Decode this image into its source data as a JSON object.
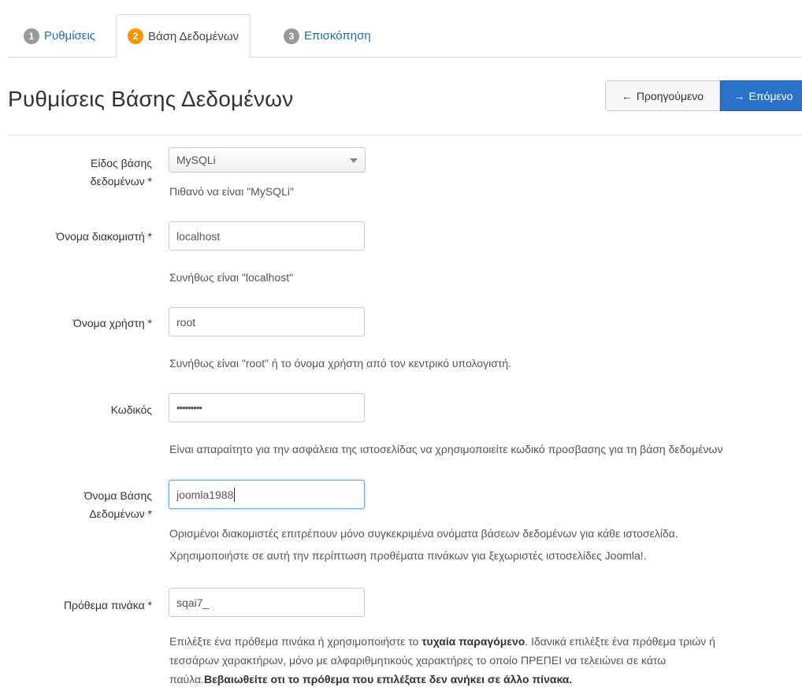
{
  "tabs": [
    {
      "num": "1",
      "label": "Ρυθμίσεις"
    },
    {
      "num": "2",
      "label": "Βάση Δεδομένων"
    },
    {
      "num": "3",
      "label": "Επισκόπηση"
    }
  ],
  "header": {
    "title": "Ρυθμίσεις Βάσης Δεδομένων",
    "prev_label": "Προηγούμενο",
    "next_label": "Επόμενο"
  },
  "form": {
    "db_type": {
      "label_line1": "Είδος βάσης",
      "label_line2": "δεδομένων *",
      "value": "MySQLi",
      "help": "Πιθανό να είναι \"MySQLi\""
    },
    "host": {
      "label": "Όνομα διακομιστή *",
      "value": "localhost",
      "help": "Συνήθως είναι \"localhost\""
    },
    "user": {
      "label": "Όνομα χρήστη *",
      "value": "root",
      "help": "Συνήθως είναι \"root\" ή το όνομα χρήστη από τον κεντρικό υπολογιστή."
    },
    "password": {
      "label": "Κωδικός",
      "value": "•••••••••",
      "help": "Είναι απαραίτητο για την ασφάλεια της ιστοσελίδας να χρησιμοποιείτε κωδικό προσβασης για τη βάση δεδομένων"
    },
    "db_name": {
      "label_line1": "Όνομα Βάσης",
      "label_line2": "Δεδομένων *",
      "value": "joomla1988",
      "help_line1": "Ορισμένοι διακομιστές επιτρέπουν μόνο συγκεκριμένα ονόματα βάσεων δεδομένων για κάθε ιστοσελίδα.",
      "help_line2": "Χρησιμοποιήστε σε αυτή την περίπτωση προθέματα πινάκων για ξεχωριστές ιστοσελίδες Joomla!."
    },
    "prefix": {
      "label": "Πρόθεμα πινάκα *",
      "value": "sqai7_",
      "help_line1_a": "Επιλέξτε ένα πρόθεμα πινάκα ή χρησιμοποιήστε το ",
      "help_line1_b": "τυχαία παραγόμενο",
      "help_line1_c": ". Ιδανικά επιλέξτε ένα πρόθεμα τριών ή",
      "help_line2": "τεσσάρων χαρακτήρων, μόνο με αλφαριθμητικούς χαρακτήρες το οποίο ΠΡΕΠΕΙ να τελειώνει σε κάτω",
      "help_line3_a": "παύλα.",
      "help_line3_b": "Βεβαιωθείτε οτι το πρόθεμα που επιλέξατε δεν ανήκει σε άλλο πίνακα."
    }
  }
}
